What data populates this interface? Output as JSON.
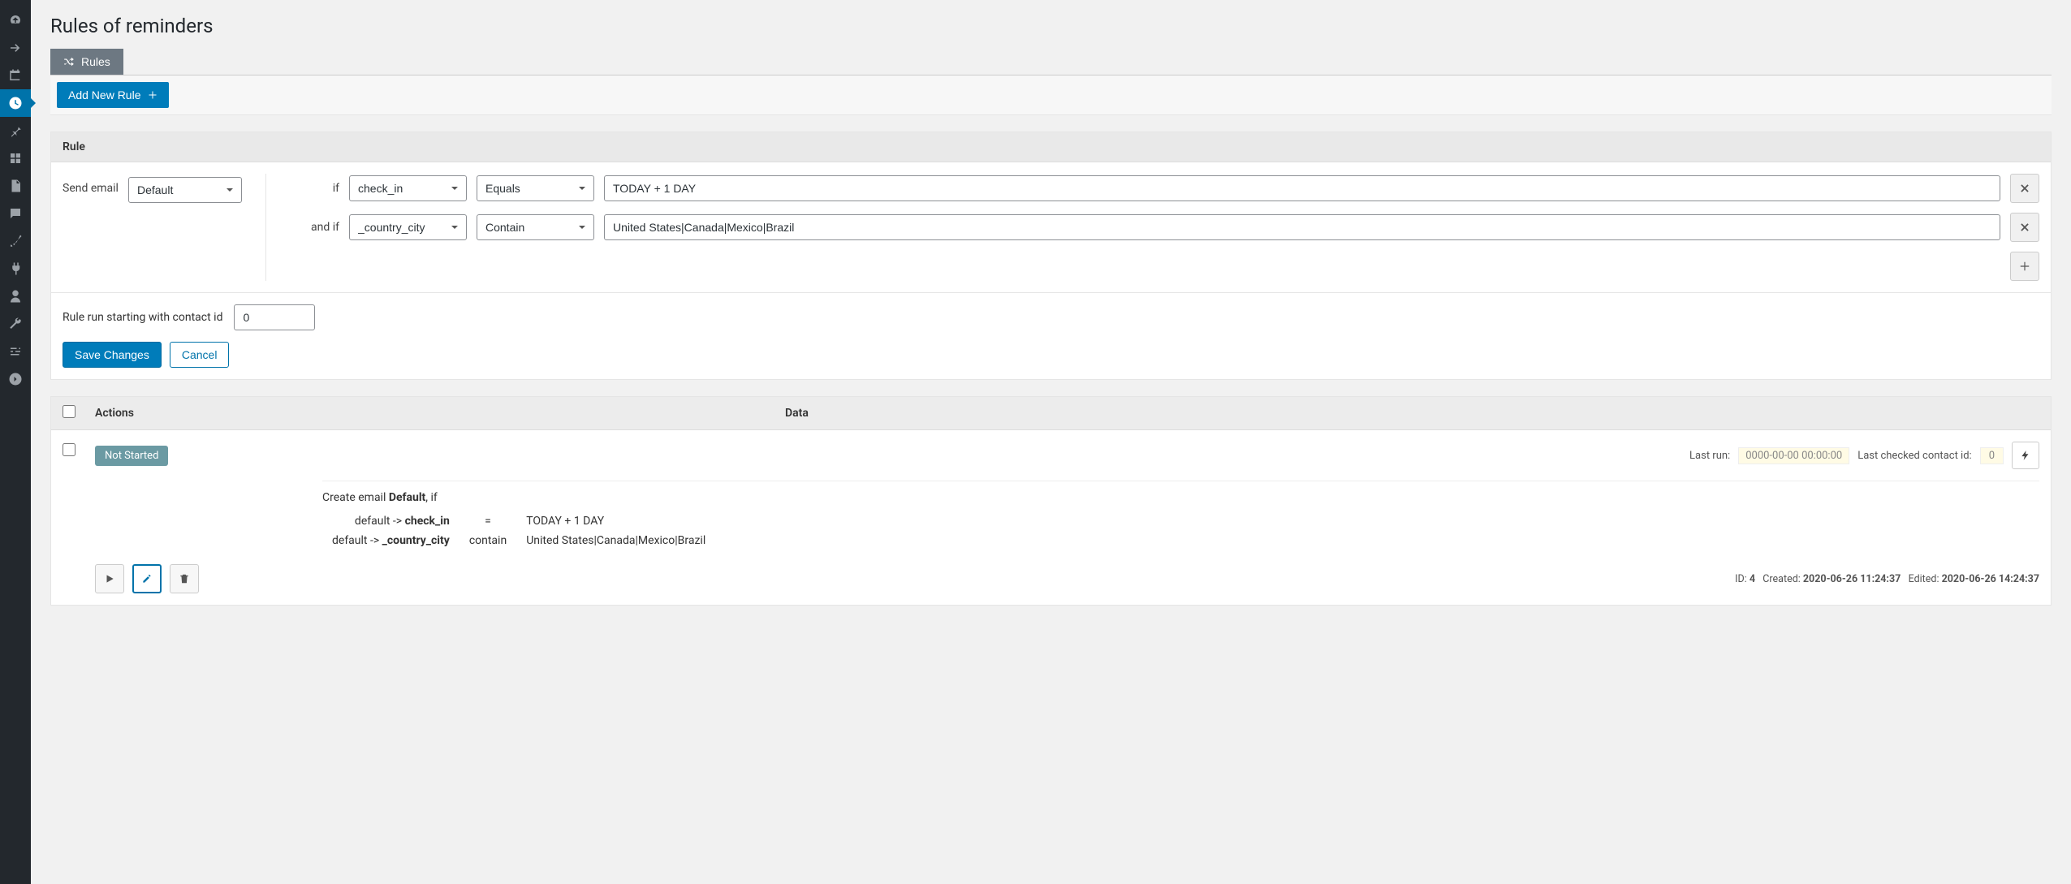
{
  "page": {
    "title": "Rules of reminders"
  },
  "tabs": {
    "rules_label": "Rules"
  },
  "buttons": {
    "add_new_rule": "Add New Rule",
    "save_changes": "Save Changes",
    "cancel": "Cancel"
  },
  "rule_panel": {
    "header": "Rule",
    "send_email_label": "Send email",
    "template_value": "Default",
    "contact_id_label": "Rule run starting with contact id",
    "contact_id_value": "0",
    "conditions": [
      {
        "prefix": "if",
        "field": "check_in",
        "op": "Equals",
        "value": "TODAY + 1 DAY"
      },
      {
        "prefix": "and if",
        "field": "_country_city",
        "op": "Contain",
        "value": "United States|Canada|Mexico|Brazil"
      }
    ]
  },
  "listing": {
    "columns": {
      "actions": "Actions",
      "data": "Data"
    },
    "row": {
      "status": "Not Started",
      "last_run_label": "Last run:",
      "last_run_value": "0000-00-00 00:00:00",
      "last_checked_label": "Last checked contact id:",
      "last_checked_value": "0",
      "summary_prefix": "Create email ",
      "summary_template": "Default",
      "summary_suffix": ", if",
      "summary_conditions": [
        {
          "left": "default -> ",
          "field": "check_in",
          "op": "=",
          "value": "TODAY + 1 DAY"
        },
        {
          "left": "default -> ",
          "field": "_country_city",
          "op": "contain",
          "value": "United States|Canada|Mexico|Brazil"
        }
      ],
      "id_label": "ID:",
      "id_value": "4",
      "created_label": "Created:",
      "created_value": "2020-06-26 11:24:37",
      "edited_label": "Edited:",
      "edited_value": "2020-06-26 14:24:37"
    }
  }
}
